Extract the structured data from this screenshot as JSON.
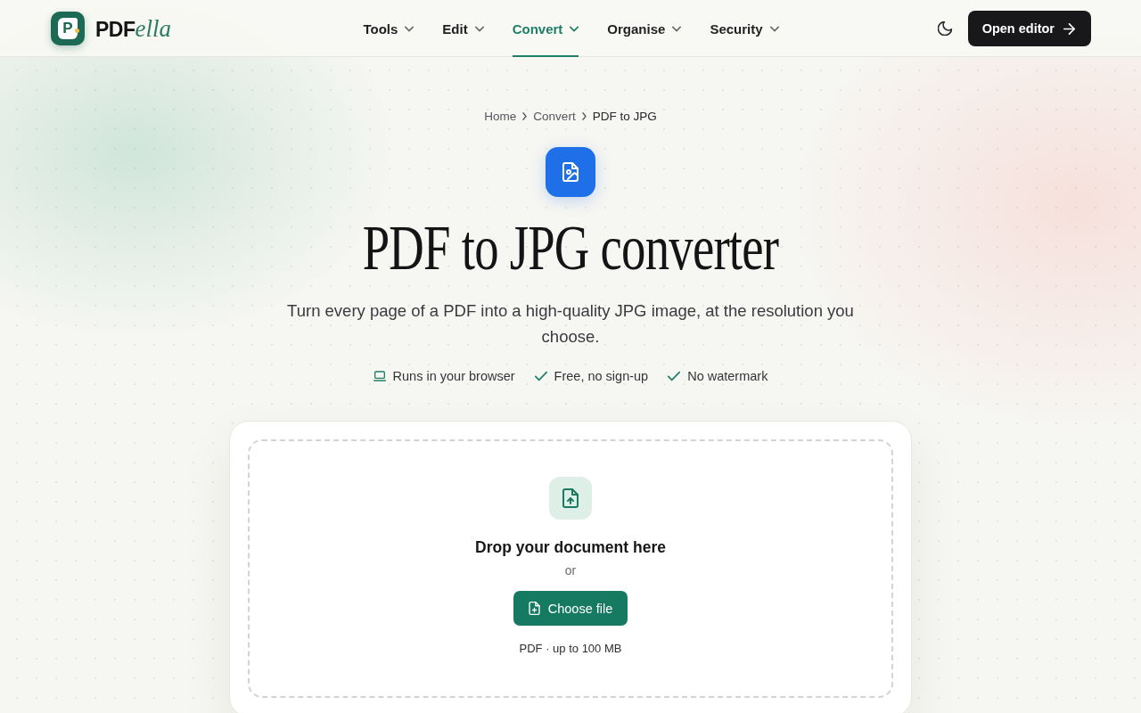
{
  "header": {
    "logo_mark": "P",
    "logo": {
      "bold": "PDF",
      "italic": "ella"
    },
    "nav": [
      {
        "label": "Tools",
        "selected": false
      },
      {
        "label": "Edit",
        "selected": false
      },
      {
        "label": "Convert",
        "selected": true
      },
      {
        "label": "Organise",
        "selected": false
      },
      {
        "label": "Security",
        "selected": false
      }
    ],
    "open_editor_button": "Open editor"
  },
  "breadcrumb": [
    {
      "label": "Home",
      "current": false
    },
    {
      "label": "Convert",
      "current": false
    },
    {
      "label": "PDF to JPG",
      "current": true
    }
  ],
  "title": "PDF to JPG converter",
  "subtitle": "Turn every page of a PDF into a high-quality JPG image, at the resolution you choose.",
  "features": [
    "Runs in your browser",
    "Free, no sign-up",
    "No watermark"
  ],
  "upload": {
    "heading": "Drop your document here",
    "separator": "or",
    "button": "Choose file",
    "hint": "PDF · up to 100 MB"
  }
}
